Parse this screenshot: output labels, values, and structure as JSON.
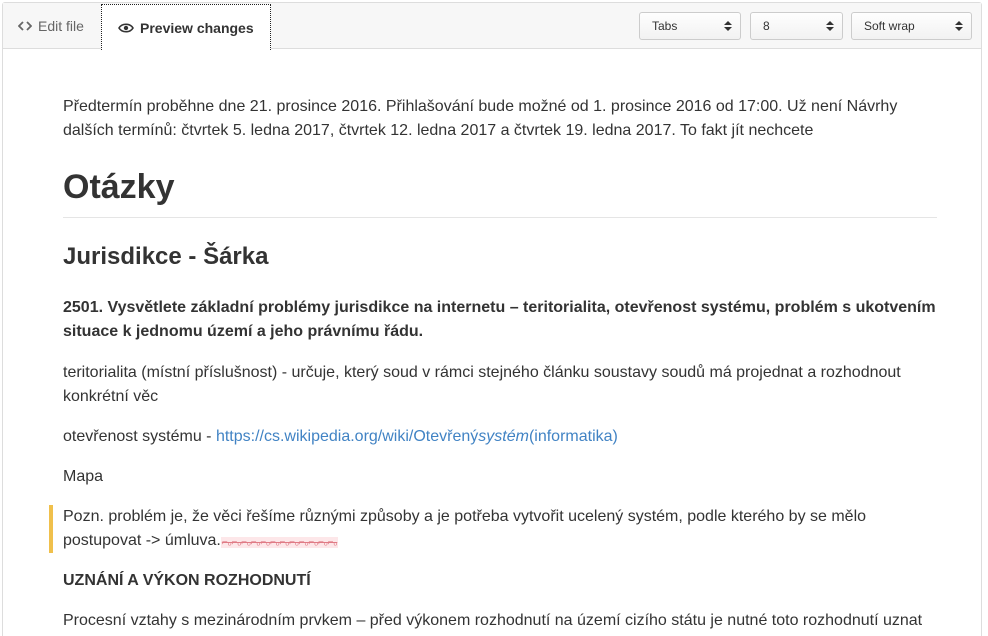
{
  "tabs": {
    "edit_label": "Edit file",
    "preview_label": "Preview changes"
  },
  "toolbar": {
    "indent_mode": "Tabs",
    "indent_size": "8",
    "wrap_mode": "Soft wrap"
  },
  "document": {
    "intro": "Předtermín proběhne dne 21. prosince 2016. Přihlašování bude možné od 1. prosince 2016 od 17:00. Už není Návrhy dalších termínů: čtvrtek 5. ledna 2017, čtvrtek 12. ledna 2017 a čtvrtek 19. ledna 2017. To fakt jít nechcete",
    "heading_1": "Otázky",
    "heading_2": "Jurisdikce - Šárka",
    "question": "2501. Vysvětlete základní problémy jurisdikce na internetu – teritorialita, otevřenost systému, problém s ukotvením situace k jednomu území a jeho právnímu řádu.",
    "territoriality": "teritorialita (místní příslušnost) - určuje, který soud v rámci stejného článku soustavy soudů má projednat a rozhodnout konkrétní věc",
    "openness_prefix": "otevřenost systému - ",
    "openness_link_a": "https://cs.wikipedia.org/wiki/Otevřený",
    "openness_link_em": "systém",
    "openness_link_b": "(informatika)",
    "map": "Mapa",
    "quote_text": "Pozn. problém je, že věci řešíme různými způsoby a je potřeba vytvořit ucelený systém, podle kterého by se mělo postupovat -> úmluva.",
    "quote_removed": "⌐ₒ⌐ₒ⌐ₒ⌐ₒ⌐ₒ⌐ₒ⌐ₒ⌐ₒ⌐ₒ⌐ₒ⌐ₒ⌐ₒ",
    "caps_heading": "UZNÁNÍ A VÝKON ROZHODNUTÍ",
    "procedural": "Procesní vztahy s mezinárodním prvkem – před výkonem rozhodnutí na území cizího státu je nutné toto rozhodnutí uznat"
  }
}
